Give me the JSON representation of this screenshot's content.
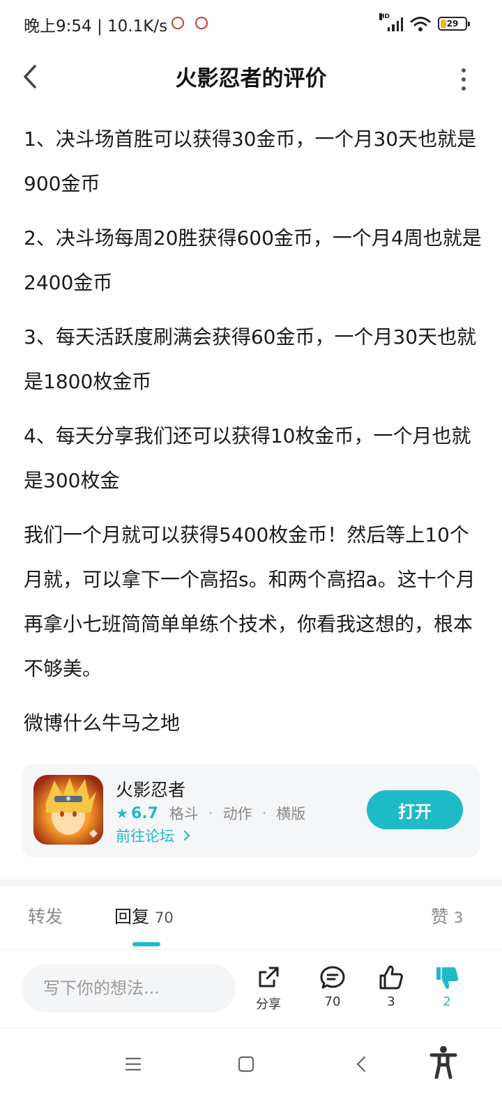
{
  "status_bar": {
    "time": "晚上9:54 | 10.1K/s",
    "network_label": "HD",
    "battery": "29",
    "icons": [
      "notification-icon",
      "notification-icon",
      "signal-icon",
      "wifi-icon",
      "battery-icon"
    ]
  },
  "header": {
    "title": "火影忍者的评价"
  },
  "post": {
    "paragraphs": [
      "1、决斗场首胜可以获得30金币，一个月30天也就是 900金币",
      "2、决斗场每周20胜获得600金币，一个月4周也就是2400金币",
      "3、每天活跃度刷满会获得60金币，一个月30天也就是1800枚金币",
      "4、每天分享我们还可以获得10枚金币，一个月也就是300枚金",
      "我们一个月就可以获得5400枚金币！然后等上10个月就，可以拿下一个高招s。和两个高招a。这十个月再拿小七班简简单单练个技术，你看我这想的，根本不够美。",
      "微博什么牛马之地"
    ]
  },
  "app_card": {
    "name": "火影忍者",
    "rating": "6.7",
    "tags": [
      "格斗",
      "动作",
      "横版"
    ],
    "forum_link": "前往论坛",
    "open_label": "打开",
    "accent_color": "#1fbac7"
  },
  "tabs": {
    "repost": "转发",
    "reply": "回复",
    "reply_count": "70",
    "like": "赞",
    "like_count": "3"
  },
  "action_bar": {
    "input_placeholder": "写下你的想法...",
    "share_label": "分享",
    "comment_count": "70",
    "like_count": "3",
    "dislike_count": "2"
  }
}
